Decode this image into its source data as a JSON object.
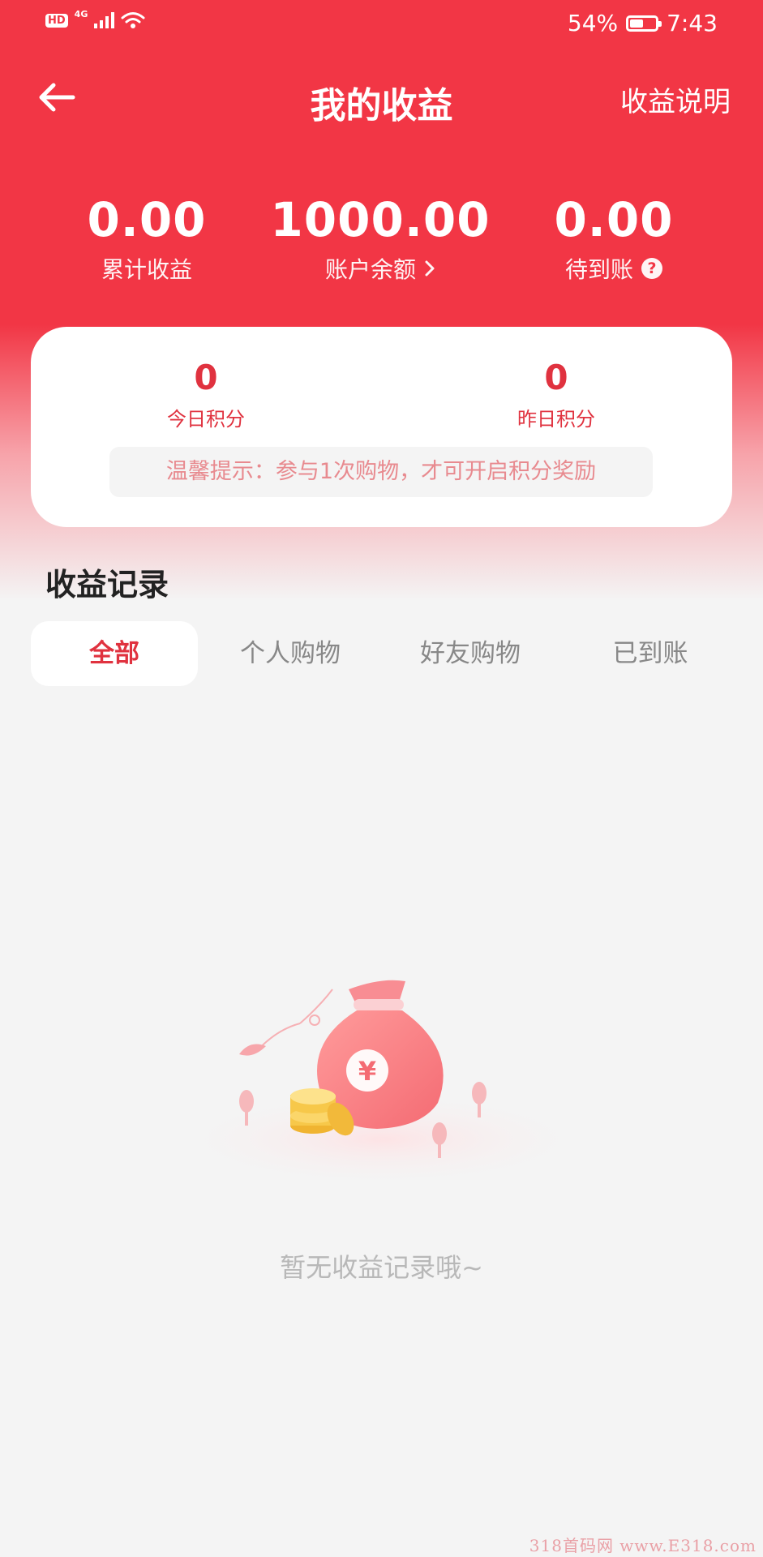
{
  "status_bar": {
    "hd": "HD",
    "network": "4G",
    "battery": "54%",
    "battery_level": 0.54,
    "time": "7:43"
  },
  "nav": {
    "title": "我的收益",
    "right_link": "收益说明"
  },
  "stats": [
    {
      "value": "0.00",
      "label": "累计收益"
    },
    {
      "value": "1000.00",
      "label": "账户余额"
    },
    {
      "value": "0.00",
      "label": "待到账"
    }
  ],
  "points": {
    "today_value": "0",
    "today_label": "今日积分",
    "yesterday_value": "0",
    "yesterday_label": "昨日积分",
    "tip": "温馨提示：参与1次购物，才可开启积分奖励"
  },
  "records": {
    "title": "收益记录",
    "tabs": [
      "全部",
      "个人购物",
      "好友购物",
      "已到账"
    ],
    "active_tab": 0,
    "empty_text": "暂无收益记录哦~"
  },
  "icons": {
    "back": "arrow-left-icon",
    "balance_chevron": "chevron-right-icon",
    "pending_help": "question-circle-icon",
    "empty": "money-bag-illustration"
  },
  "colors": {
    "brand": "#f23645",
    "accent_text": "#e0323f",
    "tip_text": "#e88a8f"
  },
  "watermark": "318首码网 www.E318.com"
}
